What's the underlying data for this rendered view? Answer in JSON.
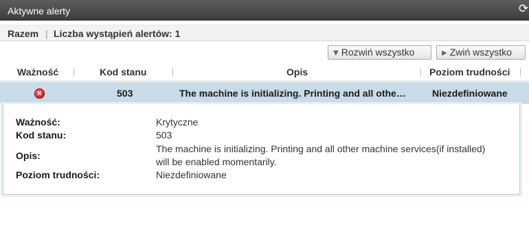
{
  "window": {
    "title": "Aktywne alerty",
    "refresh_icon": "refresh-icon"
  },
  "summary": {
    "total_label": "Razem",
    "separator": "|",
    "count_label": "Liczba wystąpień alertów: 1"
  },
  "toolbar": {
    "expand_label": "Rozwiń wszystko",
    "expand_icon": "▼",
    "collapse_label": "Zwiń wszystko",
    "collapse_icon": "▶"
  },
  "table": {
    "columns": [
      "Ważność",
      "Kod stanu",
      "Opis",
      "Poziom trudności"
    ],
    "rows": [
      {
        "severity_icon": "error-icon",
        "status_code": "503",
        "description": "The machine is initializing. Printing and all othe…",
        "difficulty": "Niezdefiniowane"
      }
    ]
  },
  "detail": {
    "severity_label": "Ważność:",
    "severity_value": "Krytyczne",
    "code_label": "Kod stanu:",
    "code_value": "503",
    "description_label": "Opis:",
    "description_line1": "The machine is initializing. Printing and all other machine services(if installed)",
    "description_line2": "will be enabled momentarily.",
    "difficulty_label": "Poziom trudności:",
    "difficulty_value": "Niezdefiniowane"
  },
  "colors": {
    "titlebar": "#4a4a4a",
    "row_selected": "#c8dbe7",
    "error": "#d42a2a"
  }
}
